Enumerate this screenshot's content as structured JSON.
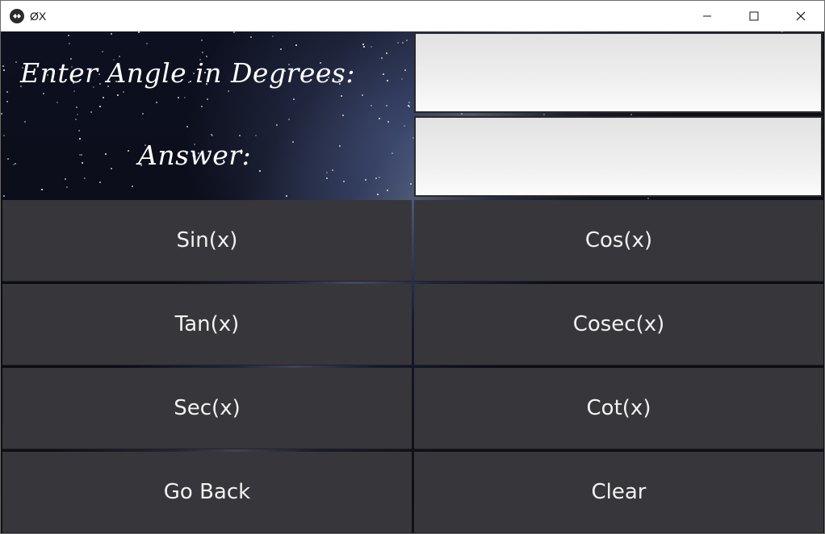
{
  "window": {
    "title": "ØX"
  },
  "labels": {
    "angle": "Enter Angle in Degrees:",
    "answer": "Answer:"
  },
  "fields": {
    "angle_value": "",
    "answer_value": ""
  },
  "buttons": {
    "sin": "Sin(x)",
    "cos": "Cos(x)",
    "tan": "Tan(x)",
    "cosec": "Cosec(x)",
    "sec": "Sec(x)",
    "cot": "Cot(x)",
    "go_back": "Go Back",
    "clear": "Clear"
  },
  "icons": {
    "app": "kivy-app-icon",
    "minimize": "minimize-icon",
    "maximize": "maximize-icon",
    "close": "close-icon"
  },
  "colors": {
    "button_bg": "#37363b",
    "button_text": "#f2f2f2",
    "label_text": "#ffffff",
    "field_bg": "#ececec"
  }
}
